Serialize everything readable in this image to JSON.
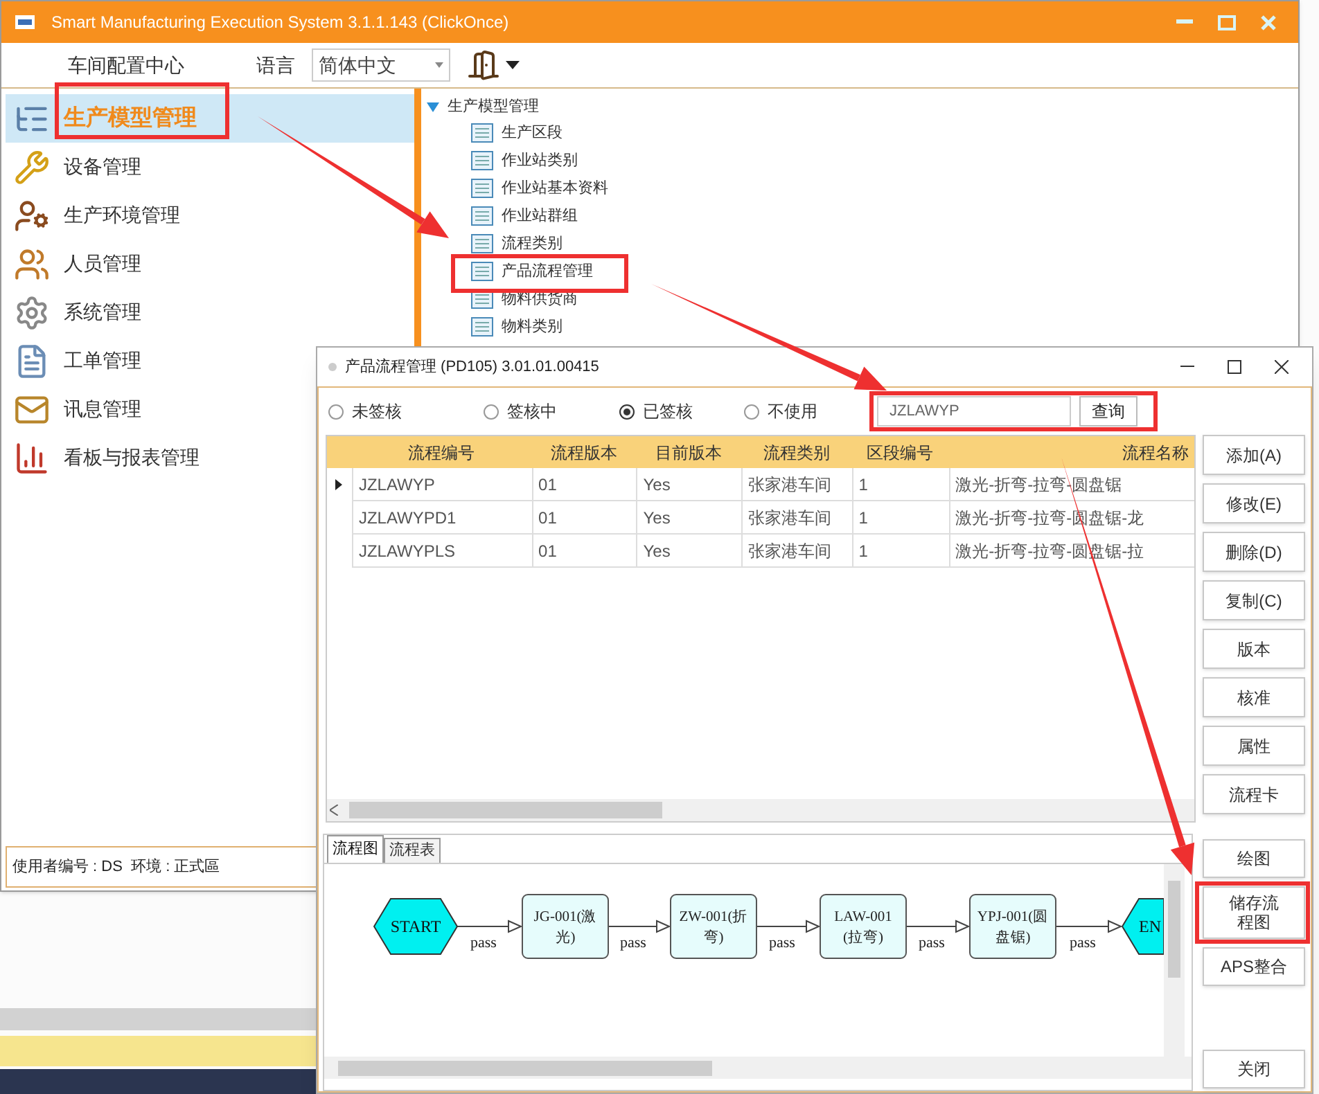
{
  "main_window": {
    "title": "Smart Manufacturing Execution System 3.1.1.143 (ClickOnce)",
    "toolbar": {
      "workshop_center": "车间配置中心",
      "language_label": "语言",
      "language_value": "简体中文"
    },
    "sidebar": {
      "items": [
        {
          "label": "生产模型管理",
          "selected": true
        },
        {
          "label": "设备管理",
          "selected": false
        },
        {
          "label": "生产环境管理",
          "selected": false
        },
        {
          "label": "人员管理",
          "selected": false
        },
        {
          "label": "系统管理",
          "selected": false
        },
        {
          "label": "工单管理",
          "selected": false
        },
        {
          "label": "讯息管理",
          "selected": false
        },
        {
          "label": "看板与报表管理",
          "selected": false
        }
      ]
    },
    "tree": {
      "label": "生产模型管理",
      "expanded": true,
      "children": [
        {
          "label": "生产区段"
        },
        {
          "label": "作业站类别"
        },
        {
          "label": "作业站基本资料"
        },
        {
          "label": "作业站群组"
        },
        {
          "label": "流程类别"
        },
        {
          "label": "产品流程管理"
        },
        {
          "label": "物料供货商"
        },
        {
          "label": "物料类别"
        }
      ]
    },
    "status_bar": "使用者编号 : DS  环境 : 正式區"
  },
  "dialog": {
    "title": "产品流程管理 (PD105) 3.01.01.00415",
    "filters": [
      {
        "label": "未签核",
        "selected": false
      },
      {
        "label": "签核中",
        "selected": false
      },
      {
        "label": "已签核",
        "selected": true
      },
      {
        "label": "不使用",
        "selected": false
      }
    ],
    "search": {
      "value": "JZLAWYP"
    },
    "query_button": "查询",
    "table": {
      "columns": [
        "流程编号",
        "流程版本",
        "目前版本",
        "流程类别",
        "区段编号",
        "流程名称"
      ],
      "rows": [
        {
          "current": true,
          "cells": [
            "JZLAWYP",
            "01",
            "Yes",
            "张家港车间",
            "1",
            "激光-折弯-拉弯-圆盘锯"
          ]
        },
        {
          "current": false,
          "cells": [
            "JZLAWYPD1",
            "01",
            "Yes",
            "张家港车间",
            "1",
            "激光-折弯-拉弯-圆盘锯-龙"
          ]
        },
        {
          "current": false,
          "cells": [
            "JZLAWYPLS",
            "01",
            "Yes",
            "张家港车间",
            "1",
            "激光-折弯-拉弯-圆盘锯-拉"
          ]
        }
      ]
    },
    "side_buttons": [
      "添加(A)",
      "修改(E)",
      "删除(D)",
      "复制(C)",
      "版本",
      "核准",
      "属性",
      "流程卡"
    ],
    "tabs": [
      {
        "label": "流程图",
        "selected": true
      },
      {
        "label": "流程表",
        "selected": false
      }
    ],
    "flow": {
      "nodes": [
        {
          "kind": "terminal",
          "lines": [
            "START"
          ]
        },
        {
          "kind": "step",
          "lines": [
            "JG-001(激",
            "光)"
          ]
        },
        {
          "kind": "step",
          "lines": [
            "ZW-001(折",
            "弯)"
          ]
        },
        {
          "kind": "step",
          "lines": [
            "LAW-001",
            "(拉弯)"
          ]
        },
        {
          "kind": "step",
          "lines": [
            "YPJ-001(圆",
            "盘锯)"
          ]
        },
        {
          "kind": "terminal_cut",
          "lines": [
            "EN"
          ]
        }
      ],
      "edges": [
        {
          "label": "pass"
        },
        {
          "label": "pass"
        },
        {
          "label": "pass"
        },
        {
          "label": "pass"
        },
        {
          "label": "pass"
        }
      ]
    },
    "lower_buttons": [
      "绘图",
      "储存流程图",
      "APS整合"
    ],
    "close_button": "关闭"
  }
}
